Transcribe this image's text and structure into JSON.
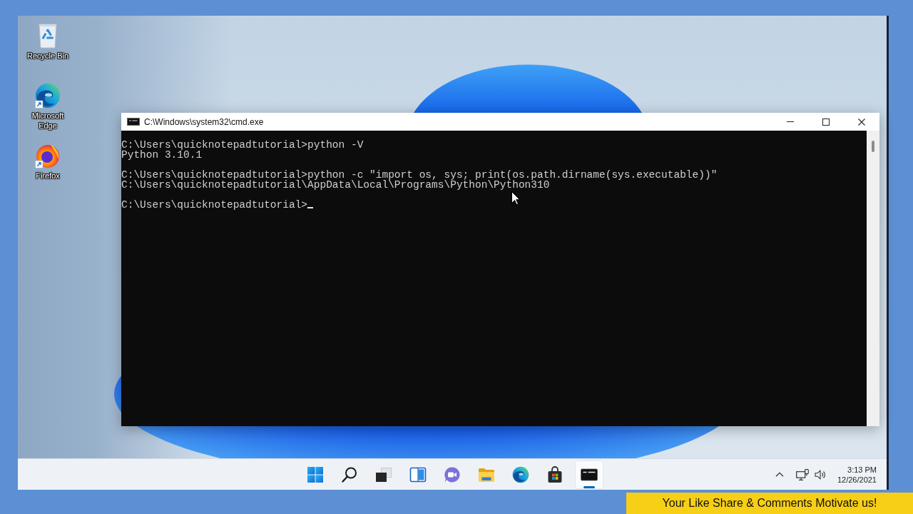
{
  "desktop": {
    "icons": [
      {
        "kind": "recycle_bin",
        "label": "Recycle Bin",
        "shortcut": false
      },
      {
        "kind": "edge",
        "label": "Microsoft Edge",
        "shortcut": true
      },
      {
        "kind": "firefox",
        "label": "Firefox",
        "shortcut": true
      }
    ]
  },
  "window": {
    "title": "C:\\Windows\\system32\\cmd.exe",
    "console": {
      "blocks": [
        {
          "lines": [
            "C:\\Users\\quicknotepadtutorial>python -V",
            "Python 3.10.1"
          ]
        },
        {
          "lines": [
            "C:\\Users\\quicknotepadtutorial>python -c \"import os, sys; print(os.path.dirname(sys.executable))\"",
            "C:\\Users\\quicknotepadtutorial\\AppData\\Local\\Programs\\Python\\Python310"
          ]
        },
        {
          "lines": [
            "C:\\Users\\quicknotepadtutorial>"
          ]
        }
      ],
      "cursor": true
    }
  },
  "taskbar": {
    "items": [
      {
        "kind": "start",
        "selected": false
      },
      {
        "kind": "search",
        "selected": false
      },
      {
        "kind": "task_view",
        "selected": false
      },
      {
        "kind": "widgets",
        "selected": false
      },
      {
        "kind": "chat",
        "selected": false
      },
      {
        "kind": "file_explorer",
        "selected": false
      },
      {
        "kind": "edge",
        "selected": false
      },
      {
        "kind": "store",
        "selected": false
      },
      {
        "kind": "terminal",
        "selected": true
      }
    ],
    "clock": {
      "time": "3:13 PM",
      "date": "12/26/2021"
    }
  },
  "banner": {
    "text": "Your Like Share & Comments Motivate us!"
  }
}
